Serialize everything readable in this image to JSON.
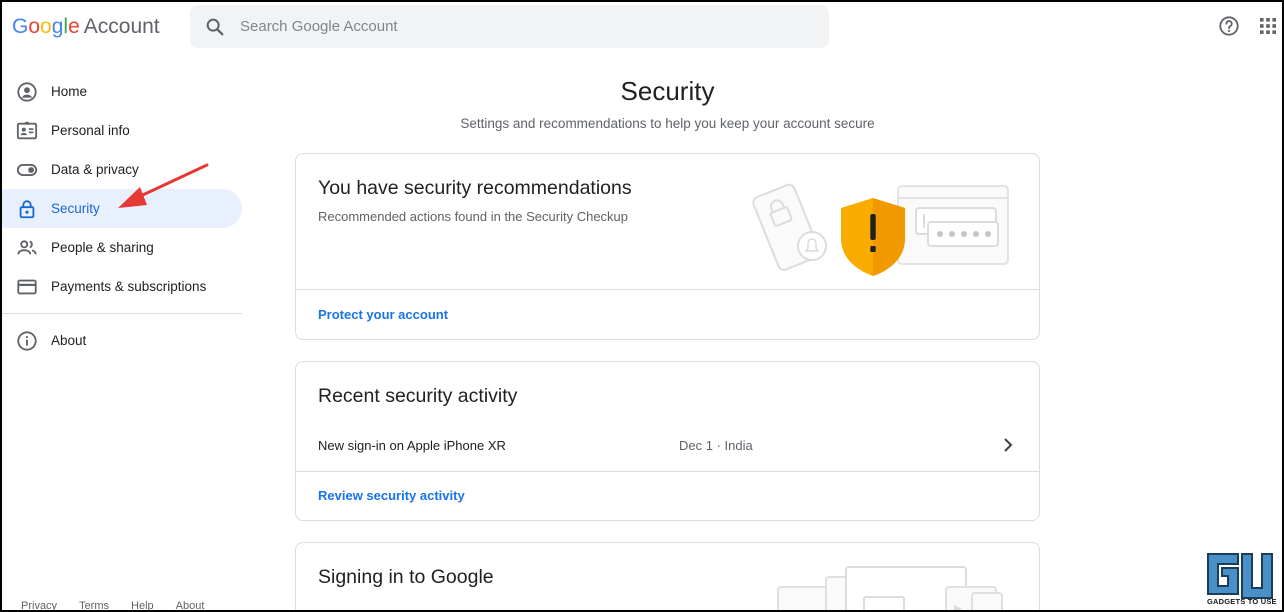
{
  "header": {
    "brand_word": "Google",
    "brand_suffix": "Account",
    "search_placeholder": "Search Google Account"
  },
  "sidebar": {
    "items": [
      {
        "label": "Home",
        "icon": "account-circle-icon"
      },
      {
        "label": "Personal info",
        "icon": "badge-icon"
      },
      {
        "label": "Data & privacy",
        "icon": "toggle-icon"
      },
      {
        "label": "Security",
        "icon": "lock-icon",
        "active": true
      },
      {
        "label": "People & sharing",
        "icon": "people-icon"
      },
      {
        "label": "Payments & subscriptions",
        "icon": "credit-card-icon"
      }
    ],
    "about": {
      "label": "About",
      "icon": "info-icon"
    }
  },
  "footer": {
    "links": [
      "Privacy",
      "Terms",
      "Help",
      "About"
    ]
  },
  "main": {
    "title": "Security",
    "subtitle": "Settings and recommendations to help you keep your account secure",
    "recommendations": {
      "title": "You have security recommendations",
      "description": "Recommended actions found in the Security Checkup",
      "link": "Protect your account"
    },
    "recent_activity": {
      "title": "Recent security activity",
      "item_text": "New sign-in on Apple iPhone XR",
      "item_meta": "Dec 1 · India",
      "link": "Review security activity"
    },
    "signing_in": {
      "title": "Signing in to Google"
    }
  },
  "watermark": {
    "text": "GADGETS TO USE"
  },
  "colors": {
    "accent": "#1a73e8",
    "active_bg": "#e8f0fe",
    "warning_shield": "#F9AB00",
    "annotation_arrow": "#E53935"
  }
}
